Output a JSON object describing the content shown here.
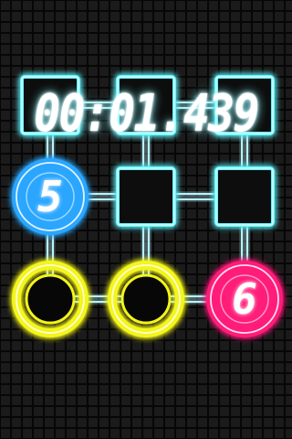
{
  "game": {
    "timer": "00:01.439",
    "colors": {
      "background": "#070707",
      "grid_tile": "#1b1b1b",
      "connector": "#b8f4ff",
      "square_glow": "#5ff6ff",
      "blue_ring": "#2aa6ff",
      "yellow_ring": "#f4f51a",
      "pink_ring": "#ff1f7a",
      "digit_glow": "#7ef6ff"
    },
    "board": {
      "rows": [
        [
          {
            "kind": "square",
            "symbol": "",
            "color": "square_glow"
          },
          {
            "kind": "square",
            "symbol": "",
            "color": "square_glow"
          },
          {
            "kind": "square",
            "symbol": "",
            "color": "square_glow"
          }
        ],
        [
          {
            "kind": "circle",
            "symbol": "5",
            "color": "blue_ring"
          },
          {
            "kind": "square",
            "symbol": "",
            "color": "square_glow"
          },
          {
            "kind": "square",
            "symbol": "",
            "color": "square_glow"
          }
        ],
        [
          {
            "kind": "circle",
            "symbol": "",
            "color": "yellow_ring"
          },
          {
            "kind": "circle",
            "symbol": "",
            "color": "yellow_ring"
          },
          {
            "kind": "circle",
            "symbol": "6",
            "color": "pink_ring"
          }
        ]
      ]
    }
  }
}
